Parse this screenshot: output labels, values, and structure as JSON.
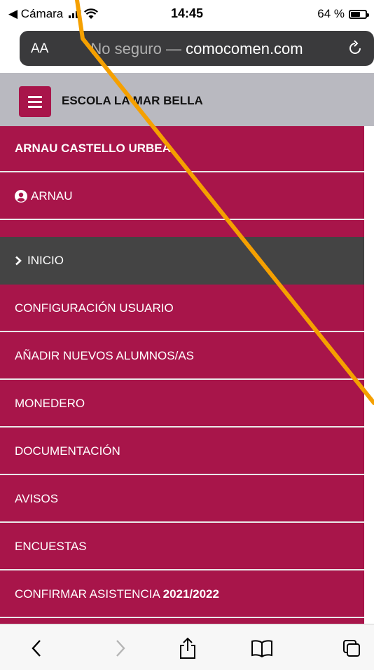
{
  "status_bar": {
    "back_app": "◀ Cámara",
    "time": "14:45",
    "battery": "64 %",
    "battery_level": 0.64
  },
  "browser": {
    "text_size_label": "AA",
    "insecure_label": "No seguro —",
    "domain": "comocomen.com"
  },
  "header": {
    "school_name": "ESCOLA LA MAR BELLA"
  },
  "menu": {
    "user_full_name": "ARNAU CASTELLO URBEA",
    "username": "ARNAU",
    "items": [
      {
        "label": "INICIO"
      },
      {
        "label": "CONFIGURACIÓN USUARIO"
      },
      {
        "label": "AÑADIR NUEVOS ALUMNOS/AS"
      },
      {
        "label": "MONEDERO"
      },
      {
        "label": "DOCUMENTACIÓN"
      },
      {
        "label": "AVISOS"
      },
      {
        "label": "ENCUESTAS"
      },
      {
        "label": "CONFIRMAR ASISTENCIA",
        "year": "2021/2022"
      }
    ]
  },
  "colors": {
    "brand": "#a8154a",
    "active_item": "#444444",
    "header_bg": "#b9b9c0",
    "annotation": "#f5a000"
  }
}
